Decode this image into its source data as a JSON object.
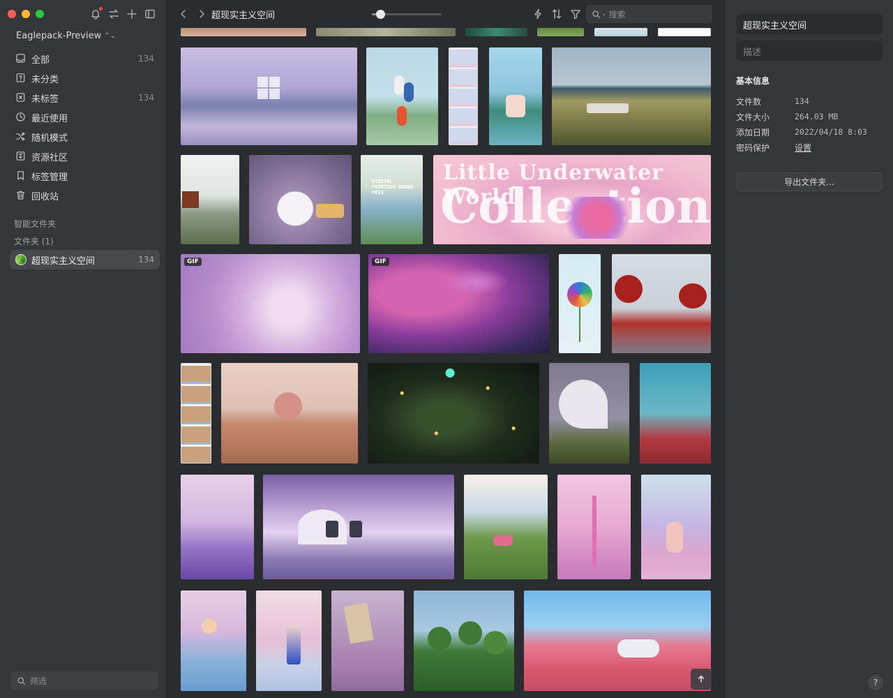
{
  "sidebar": {
    "library": "Eaglepack-Preview",
    "items": [
      {
        "label": "全部",
        "count": "134",
        "icon": "all-icon"
      },
      {
        "label": "未分类",
        "count": "",
        "icon": "uncategorized-icon"
      },
      {
        "label": "未标签",
        "count": "134",
        "icon": "untagged-icon"
      },
      {
        "label": "最近使用",
        "count": "",
        "icon": "recent-icon"
      },
      {
        "label": "随机模式",
        "count": "",
        "icon": "shuffle-icon"
      },
      {
        "label": "资源社区",
        "count": "",
        "icon": "community-icon"
      },
      {
        "label": "标签管理",
        "count": "",
        "icon": "tag-manage-icon"
      },
      {
        "label": "回收站",
        "count": "",
        "icon": "trash-icon"
      }
    ],
    "smart_folders_label": "智能文件夹",
    "folders_label": "文件夹 (1)",
    "folder": {
      "label": "超现实主义空间",
      "count": "134"
    },
    "filter_placeholder": "筛选"
  },
  "toolbar": {
    "title": "超现实主义空间",
    "zoom": 0.12,
    "search_placeholder": "搜索"
  },
  "grid": {
    "badges": [
      "GIF",
      "GIF"
    ],
    "collection_text_1": "Little Underwater World",
    "collection_text_2": "Collection",
    "poster_text": "DIGITAL FRONTIER GRAND PRIX"
  },
  "inspector": {
    "title": "超现实主义空间",
    "description_placeholder": "描述",
    "section": "基本信息",
    "rows": [
      {
        "key": "文件数",
        "value": "134"
      },
      {
        "key": "文件大小",
        "value": "264.03 MB"
      },
      {
        "key": "添加日期",
        "value": "2022/04/18 8:03"
      },
      {
        "key": "密码保护",
        "value": "设置"
      }
    ],
    "export_label": "导出文件夹...",
    "help_label": "?"
  }
}
